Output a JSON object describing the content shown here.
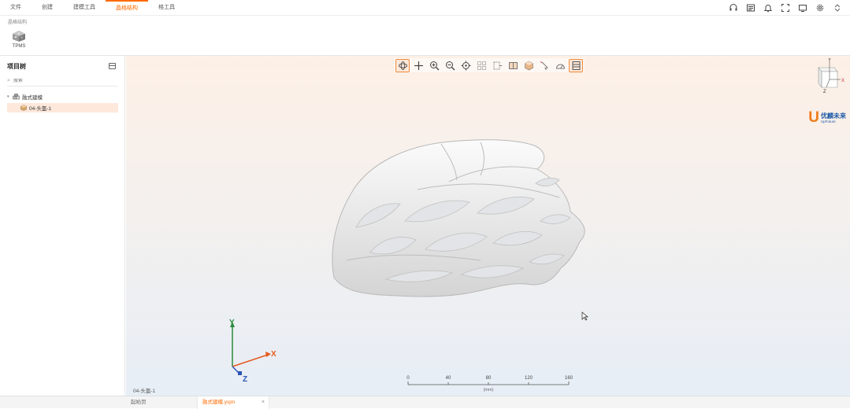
{
  "menubar": {
    "items": [
      {
        "label": "文件"
      },
      {
        "label": "创建"
      },
      {
        "label": "建模工具"
      },
      {
        "label": "晶格结构"
      },
      {
        "label": "格工具"
      }
    ],
    "active_index": 3,
    "icons": [
      "headset-icon",
      "notes-icon",
      "bell-icon",
      "fullscreen-icon",
      "monitor-icon",
      "gear-icon",
      "expand-icon"
    ]
  },
  "ribbon": {
    "group_label": "晶格结构",
    "tpms_label": "TPMS",
    "tpms_icon": "lattice-cube-icon"
  },
  "sidebar": {
    "title": "项目树",
    "search_placeholder": "搜索",
    "tree": [
      {
        "label": "融式建模",
        "icon": "assembly-icon",
        "expanded": true
      },
      {
        "label": "04-头盔-1",
        "icon": "part-icon",
        "selected": true
      }
    ]
  },
  "viewport": {
    "toolbar_icons": [
      "rotate-icon",
      "pan-icon",
      "zoom-in-icon",
      "zoom-area-icon",
      "fit-view-icon",
      "select-box-icon",
      "section-icon",
      "view-box-icon",
      "shading-icon",
      "pick-icon",
      "measure-icon",
      "display-mode-icon"
    ],
    "toolbar_active_index": 0,
    "brand": {
      "mark": "U",
      "name": "优麟未来",
      "sub": "UpFuture"
    },
    "axes": {
      "x": "X",
      "y": "Y",
      "z": "Z"
    },
    "cube_axes": {
      "x": "X",
      "y": "Y",
      "z": "Z"
    },
    "model_name": "04-头盔-1",
    "scale": {
      "ticks": [
        "0",
        "40",
        "80",
        "120",
        "160"
      ],
      "unit": "(mm)"
    }
  },
  "bottom_tabs": {
    "tabs": [
      {
        "label": "起始页"
      },
      {
        "label": "融式建模.ysjm",
        "closable": true
      }
    ],
    "active_index": 1,
    "close_glyph": "×"
  },
  "colors": {
    "accent": "#ff6a00",
    "brand_blue": "#1f5aa8",
    "axis_x": "#e65a1e",
    "axis_y": "#2a8a3a",
    "axis_z": "#2b55b5"
  }
}
